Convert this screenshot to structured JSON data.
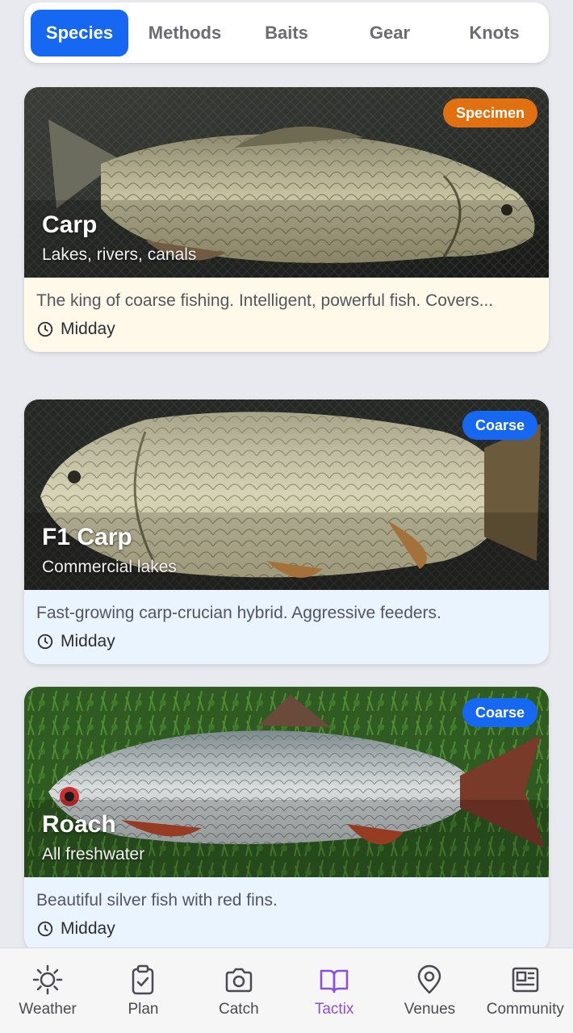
{
  "tabs": [
    {
      "label": "Species",
      "active": true
    },
    {
      "label": "Methods",
      "active": false
    },
    {
      "label": "Baits",
      "active": false
    },
    {
      "label": "Gear",
      "active": false
    },
    {
      "label": "Knots",
      "active": false
    }
  ],
  "cards": [
    {
      "title": "Carp",
      "subtitle": "Lakes, rivers, canals",
      "badge": "Specimen",
      "badge_color": "#e07010",
      "description": "The king of coarse fishing. Intelligent, powerful fish. Covers...",
      "time": "Midday",
      "body_bg": "#fef9e8"
    },
    {
      "title": "F1 Carp",
      "subtitle": "Commercial lakes",
      "badge": "Coarse",
      "badge_color": "#1668f2",
      "description": "Fast-growing carp-crucian hybrid. Aggressive feeders.",
      "time": "Midday",
      "body_bg": "#eaf4fe"
    },
    {
      "title": "Roach",
      "subtitle": "All freshwater",
      "badge": "Coarse",
      "badge_color": "#1668f2",
      "description": "Beautiful silver fish with red fins.",
      "time": "Midday",
      "body_bg": "#eaf4fe"
    }
  ],
  "nav": [
    {
      "label": "Weather",
      "icon": "sun-icon",
      "active": false
    },
    {
      "label": "Plan",
      "icon": "clipboard-check-icon",
      "active": false
    },
    {
      "label": "Catch",
      "icon": "camera-icon",
      "active": false
    },
    {
      "label": "Tactix",
      "icon": "book-open-icon",
      "active": true
    },
    {
      "label": "Venues",
      "icon": "map-pin-icon",
      "active": false
    },
    {
      "label": "Community",
      "icon": "newspaper-icon",
      "active": false
    }
  ],
  "colors": {
    "accent": "#1668f2",
    "active_nav": "#8a4fe0",
    "specimen_badge": "#e07010"
  }
}
